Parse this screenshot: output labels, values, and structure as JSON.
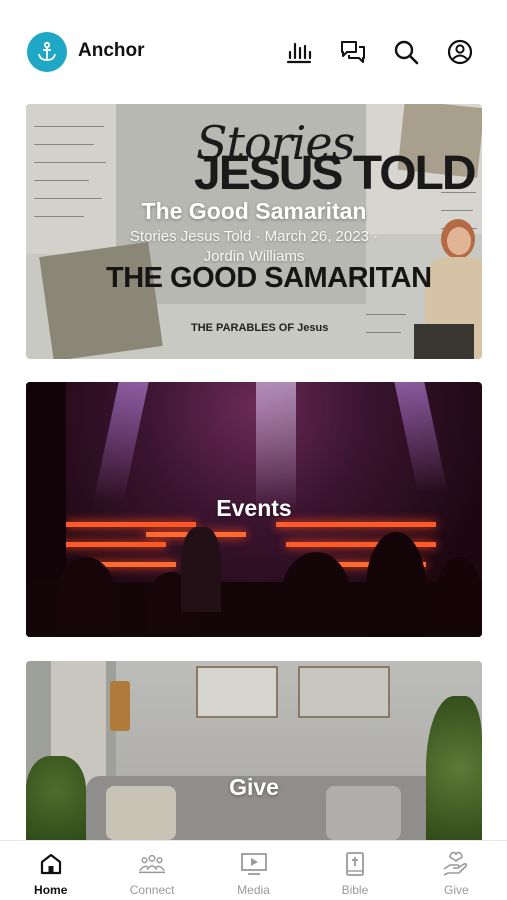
{
  "header": {
    "app_title": "Anchor",
    "icons": [
      "anchor-logo-icon",
      "audio-bars-icon",
      "chat-icon",
      "search-icon",
      "account-icon"
    ],
    "brand_color": "#1fa8c6"
  },
  "cards": [
    {
      "title": "The Good Samaritan",
      "subtitle": "Stories Jesus Told · March 26, 2023 ·",
      "speaker": "Jordin Williams",
      "art": {
        "stories": "Stories",
        "jesus_told": "JESUS TOLD",
        "headline": "THE GOOD SAMARITAN",
        "footer": "THE PARABLES OF Jesus"
      }
    },
    {
      "title": "Events"
    },
    {
      "title": "Give"
    }
  ],
  "bottom_nav": {
    "items": [
      {
        "label": "Home",
        "icon": "home-icon",
        "active": true
      },
      {
        "label": "Connect",
        "icon": "people-icon",
        "active": false
      },
      {
        "label": "Media",
        "icon": "media-icon",
        "active": false
      },
      {
        "label": "Bible",
        "icon": "bible-icon",
        "active": false
      },
      {
        "label": "Give",
        "icon": "give-icon",
        "active": false
      }
    ],
    "active_color": "#111111",
    "inactive_color": "#9a9a9a"
  }
}
